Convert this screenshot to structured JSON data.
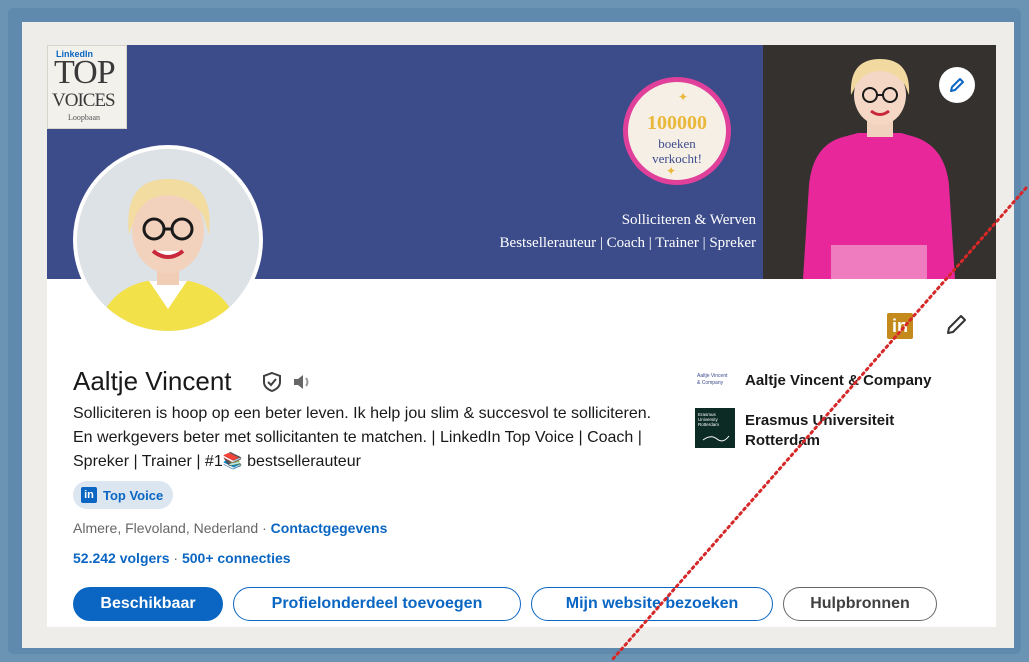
{
  "banner": {
    "topvoices_badge": {
      "small": "LinkedIn",
      "line1": "TOP",
      "line2": "VOICES",
      "line3": "Loopbaan"
    },
    "circle_badge": {
      "number": "100000",
      "line1": "boeken",
      "line2": "verkocht!"
    },
    "tagline_line1": "Solliciteren & Werven",
    "tagline_line2": "Bestsellerauteur | Coach | Trainer | Spreker"
  },
  "profile": {
    "name": "Aaltje Vincent",
    "headline": "Solliciteren is hoop op een beter leven. Ik help jou slim & succesvol te solliciteren. En werkgevers beter met sollicitanten te matchen. | LinkedIn Top Voice | Coach | Spreker | Trainer | #1📚 bestsellerauteur",
    "badge": "Top Voice",
    "location": "Almere, Flevoland, Nederland",
    "location_sep": " · ",
    "contact_link": "Contactgegevens",
    "followers": "52.242 volgers",
    "followers_sep": " · ",
    "connections": "500+ connecties"
  },
  "sidebar": {
    "company": "Aaltje Vincent & Company",
    "company_logo_text": "Aaltje Vincent & Company",
    "education_line1": "Erasmus Universiteit",
    "education_line2": "Rotterdam",
    "education_logo_text": "Erasmus University Rotterdam"
  },
  "buttons": {
    "available": "Beschikbaar",
    "add_section": "Profielonderdeel toevoegen",
    "website": "Mijn website bezoeken",
    "resources": "Hulpbronnen"
  },
  "colors": {
    "banner": "#3c4c8b",
    "linkedin_blue": "#0a66c2",
    "frame": "#5f8aad",
    "sweater_pink": "#e8289a",
    "dotted_red": "#d62828"
  }
}
